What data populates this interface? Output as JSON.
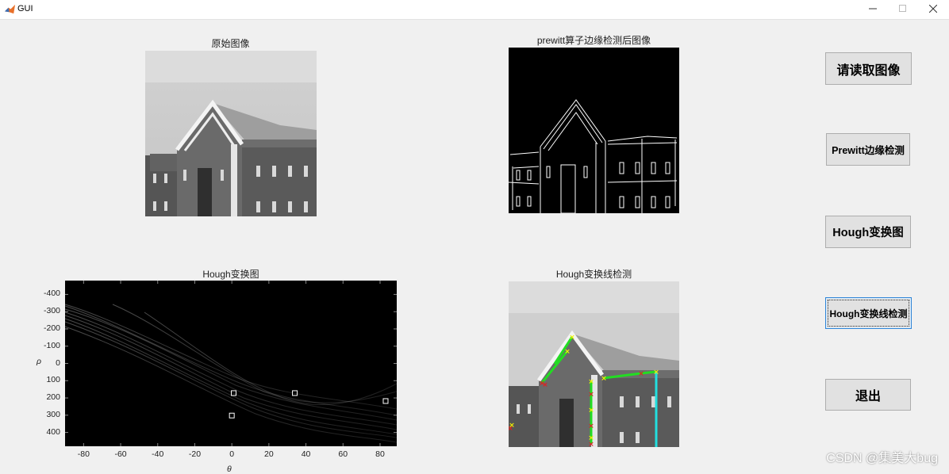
{
  "window": {
    "title": "GUI",
    "minimize": "—",
    "maximize": "☐",
    "close": "✕"
  },
  "panels": {
    "original": {
      "title": "原始图像"
    },
    "edge": {
      "title": "prewitt算子边缘检测后图像"
    },
    "hough": {
      "title": "Hough变换图",
      "xlabel": "θ",
      "ylabel": "ρ",
      "xticks": [
        "-80",
        "-60",
        "-40",
        "-20",
        "0",
        "20",
        "40",
        "60",
        "80"
      ],
      "yticks": [
        "-400",
        "-300",
        "-200",
        "-100",
        "0",
        "100",
        "200",
        "300",
        "400"
      ]
    },
    "lines": {
      "title": "Hough变换线检测"
    }
  },
  "buttons": {
    "read": "请读取图像",
    "prewitt": "Prewitt边缘检测",
    "hough": "Hough变换图",
    "hough_lines": "Hough变换线检测",
    "exit": "退出"
  },
  "chart_data": {
    "type": "heatmap",
    "title": "Hough变换图",
    "xlabel": "θ",
    "ylabel": "ρ",
    "xlim": [
      -90,
      89
    ],
    "ylim": [
      -480,
      480
    ],
    "y_reversed": true,
    "peaks": [
      {
        "theta": 1,
        "rho": 172
      },
      {
        "theta": 0,
        "rho": 302
      },
      {
        "theta": 34,
        "rho": 172
      },
      {
        "theta": 83,
        "rho": 218
      }
    ]
  },
  "watermark": "CSDN @集美大bug"
}
